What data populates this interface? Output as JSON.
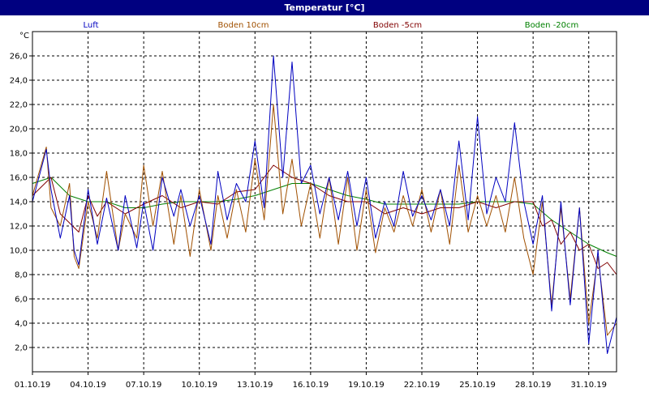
{
  "window": {
    "title": "Temperatur [°C]"
  },
  "chart_data": {
    "type": "line",
    "title": "Temperatur [°C]",
    "ylabel": "°C",
    "xlabel": "",
    "ylim": [
      0,
      28
    ],
    "xlim": [
      "01.10.19 00:00",
      "01.11.19 12:00"
    ],
    "grid": true,
    "legend_position": "top",
    "x_ticks": [
      "01.10.19",
      "04.10.19",
      "07.10.19",
      "10.10.19",
      "13.10.19",
      "16.10.19",
      "19.10.19",
      "22.10.19",
      "25.10.19",
      "28.10.19",
      "31.10.19"
    ],
    "y_ticks": [
      "2,0",
      "4,0",
      "6,0",
      "8,0",
      "10,0",
      "12,0",
      "14,0",
      "16,0",
      "18,0",
      "20,0",
      "22,0",
      "24,0",
      "26,0"
    ],
    "series": [
      {
        "name": "Luft",
        "color": "#0000c0",
        "x": [
          "01.10.19 00:00",
          "01.10.19 18:00",
          "02.10.19 00:00",
          "02.10.19 12:00",
          "03.10.19 00:00",
          "03.10.19 06:00",
          "03.10.19 12:00",
          "04.10.19 00:00",
          "04.10.19 12:00",
          "05.10.19 00:00",
          "05.10.19 15:00",
          "06.10.19 00:00",
          "06.10.19 15:00",
          "07.10.19 00:00",
          "07.10.19 12:00",
          "08.10.19 00:00",
          "08.10.19 15:00",
          "09.10.19 00:00",
          "09.10.19 12:00",
          "10.10.19 00:00",
          "10.10.19 15:00",
          "11.10.19 00:00",
          "11.10.19 12:00",
          "12.10.19 00:00",
          "12.10.19 12:00",
          "13.10.19 00:00",
          "13.10.19 12:00",
          "14.10.19 00:00",
          "14.10.19 12:00",
          "15.10.19 00:00",
          "15.10.19 12:00",
          "16.10.19 00:00",
          "16.10.19 12:00",
          "17.10.19 00:00",
          "17.10.19 12:00",
          "18.10.19 00:00",
          "18.10.19 12:00",
          "19.10.19 00:00",
          "19.10.19 12:00",
          "20.10.19 00:00",
          "20.10.19 12:00",
          "21.10.19 00:00",
          "21.10.19 12:00",
          "22.10.19 00:00",
          "22.10.19 12:00",
          "23.10.19 00:00",
          "23.10.19 12:00",
          "24.10.19 00:00",
          "24.10.19 12:00",
          "25.10.19 00:00",
          "25.10.19 12:00",
          "26.10.19 00:00",
          "26.10.19 12:00",
          "27.10.19 00:00",
          "27.10.19 12:00",
          "28.10.19 00:00",
          "28.10.19 12:00",
          "29.10.19 00:00",
          "29.10.19 12:00",
          "30.10.19 00:00",
          "30.10.19 12:00",
          "31.10.19 00:00",
          "31.10.19 12:00",
          "01.11.19 00:00",
          "01.11.19 12:00"
        ],
        "values": [
          14.0,
          18.3,
          15.0,
          11.0,
          14.5,
          10.0,
          8.8,
          15.0,
          10.5,
          14.3,
          10.0,
          14.5,
          10.2,
          14.0,
          10.0,
          16.0,
          12.8,
          15.0,
          12.0,
          14.5,
          10.5,
          16.5,
          12.5,
          15.5,
          14.0,
          19.0,
          13.5,
          26.0,
          16.0,
          25.5,
          15.5,
          17.0,
          13.0,
          16.0,
          12.5,
          16.5,
          12.0,
          16.0,
          11.0,
          14.0,
          12.0,
          16.5,
          12.8,
          14.5,
          12.5,
          15.0,
          12.0,
          19.0,
          12.5,
          21.0,
          13.0,
          16.0,
          14.0,
          20.5,
          14.0,
          10.5,
          14.5,
          5.0,
          14.0,
          5.5,
          13.5,
          2.3,
          10.0,
          1.5,
          4.5
        ]
      },
      {
        "name": "Boden 10cm",
        "color": "#a05000",
        "x": [
          "01.10.19 00:00",
          "01.10.19 18:00",
          "02.10.19 00:00",
          "02.10.19 12:00",
          "03.10.19 00:00",
          "03.10.19 06:00",
          "03.10.19 12:00",
          "04.10.19 00:00",
          "04.10.19 12:00",
          "05.10.19 00:00",
          "05.10.19 15:00",
          "06.10.19 00:00",
          "06.10.19 15:00",
          "07.10.19 00:00",
          "07.10.19 12:00",
          "08.10.19 00:00",
          "08.10.19 15:00",
          "09.10.19 00:00",
          "09.10.19 12:00",
          "10.10.19 00:00",
          "10.10.19 15:00",
          "11.10.19 00:00",
          "11.10.19 12:00",
          "12.10.19 00:00",
          "12.10.19 12:00",
          "13.10.19 00:00",
          "13.10.19 12:00",
          "14.10.19 00:00",
          "14.10.19 12:00",
          "15.10.19 00:00",
          "15.10.19 12:00",
          "16.10.19 00:00",
          "16.10.19 12:00",
          "17.10.19 00:00",
          "17.10.19 12:00",
          "18.10.19 00:00",
          "18.10.19 12:00",
          "19.10.19 00:00",
          "19.10.19 12:00",
          "20.10.19 00:00",
          "20.10.19 12:00",
          "21.10.19 00:00",
          "21.10.19 12:00",
          "22.10.19 00:00",
          "22.10.19 12:00",
          "23.10.19 00:00",
          "23.10.19 12:00",
          "24.10.19 00:00",
          "24.10.19 12:00",
          "25.10.19 00:00",
          "25.10.19 12:00",
          "26.10.19 00:00",
          "26.10.19 12:00",
          "27.10.19 00:00",
          "27.10.19 12:00",
          "28.10.19 00:00",
          "28.10.19 12:00",
          "29.10.19 00:00",
          "29.10.19 12:00",
          "30.10.19 00:00",
          "30.10.19 12:00",
          "31.10.19 00:00",
          "31.10.19 12:00",
          "01.11.19 00:00",
          "01.11.19 12:00"
        ],
        "values": [
          14.5,
          18.5,
          13.5,
          12.0,
          15.5,
          9.5,
          8.5,
          14.0,
          11.0,
          16.5,
          10.0,
          13.0,
          11.0,
          17.0,
          12.0,
          16.5,
          10.5,
          14.5,
          9.5,
          15.0,
          10.0,
          14.5,
          11.0,
          15.0,
          11.5,
          17.5,
          12.5,
          22.0,
          13.0,
          17.5,
          12.0,
          15.5,
          11.0,
          16.0,
          10.5,
          16.0,
          10.0,
          15.0,
          9.8,
          13.5,
          11.5,
          14.5,
          12.0,
          15.0,
          11.5,
          15.0,
          10.5,
          17.0,
          11.5,
          14.5,
          12.0,
          14.5,
          11.5,
          16.0,
          11.0,
          8.0,
          14.0,
          5.5,
          13.5,
          6.0,
          13.5,
          4.0,
          9.5,
          3.0,
          4.0
        ]
      },
      {
        "name": "Boden -5cm",
        "color": "#800000",
        "x": [
          "01.10.19 00:00",
          "02.10.19 00:00",
          "02.10.19 12:00",
          "03.10.19 12:00",
          "04.10.19 00:00",
          "04.10.19 12:00",
          "05.10.19 00:00",
          "06.10.19 00:00",
          "07.10.19 00:00",
          "08.10.19 00:00",
          "09.10.19 00:00",
          "10.10.19 00:00",
          "11.10.19 00:00",
          "12.10.19 00:00",
          "13.10.19 00:00",
          "14.10.19 00:00",
          "15.10.19 00:00",
          "16.10.19 00:00",
          "17.10.19 00:00",
          "18.10.19 00:00",
          "19.10.19 00:00",
          "20.10.19 00:00",
          "21.10.19 00:00",
          "22.10.19 00:00",
          "23.10.19 00:00",
          "24.10.19 00:00",
          "25.10.19 00:00",
          "26.10.19 00:00",
          "27.10.19 00:00",
          "28.10.19 00:00",
          "28.10.19 12:00",
          "29.10.19 00:00",
          "29.10.19 12:00",
          "30.10.19 00:00",
          "30.10.19 12:00",
          "31.10.19 00:00",
          "31.10.19 12:00",
          "01.11.19 00:00",
          "01.11.19 12:00"
        ],
        "values": [
          14.5,
          16.0,
          13.0,
          11.5,
          14.5,
          12.8,
          14.0,
          13.0,
          13.8,
          14.5,
          13.5,
          14.0,
          13.8,
          14.8,
          15.0,
          17.0,
          16.0,
          15.5,
          14.5,
          14.0,
          14.0,
          13.0,
          13.5,
          13.0,
          13.5,
          13.5,
          14.0,
          13.5,
          14.0,
          14.0,
          12.0,
          12.5,
          10.5,
          11.5,
          10.0,
          10.5,
          8.5,
          9.0,
          8.0
        ]
      },
      {
        "name": "Boden -20cm",
        "color": "#008000",
        "x": [
          "01.10.19 00:00",
          "02.10.19 00:00",
          "03.10.19 00:00",
          "04.10.19 00:00",
          "05.10.19 00:00",
          "06.10.19 00:00",
          "07.10.19 00:00",
          "08.10.19 00:00",
          "09.10.19 00:00",
          "10.10.19 00:00",
          "11.10.19 00:00",
          "12.10.19 00:00",
          "13.10.19 00:00",
          "14.10.19 00:00",
          "15.10.19 00:00",
          "16.10.19 00:00",
          "17.10.19 00:00",
          "18.10.19 00:00",
          "19.10.19 00:00",
          "20.10.19 00:00",
          "21.10.19 00:00",
          "22.10.19 00:00",
          "23.10.19 00:00",
          "24.10.19 00:00",
          "25.10.19 00:00",
          "26.10.19 00:00",
          "27.10.19 00:00",
          "28.10.19 00:00",
          "29.10.19 00:00",
          "30.10.19 00:00",
          "31.10.19 00:00",
          "01.11.19 00:00",
          "01.11.19 12:00"
        ],
        "values": [
          15.5,
          16.0,
          14.5,
          14.0,
          14.0,
          13.5,
          13.5,
          13.8,
          14.0,
          14.0,
          14.0,
          14.2,
          14.5,
          15.0,
          15.5,
          15.5,
          15.0,
          14.5,
          14.2,
          13.8,
          13.8,
          13.8,
          13.8,
          13.8,
          14.0,
          14.0,
          14.0,
          13.8,
          12.5,
          11.5,
          10.5,
          9.8,
          9.5
        ]
      }
    ]
  }
}
